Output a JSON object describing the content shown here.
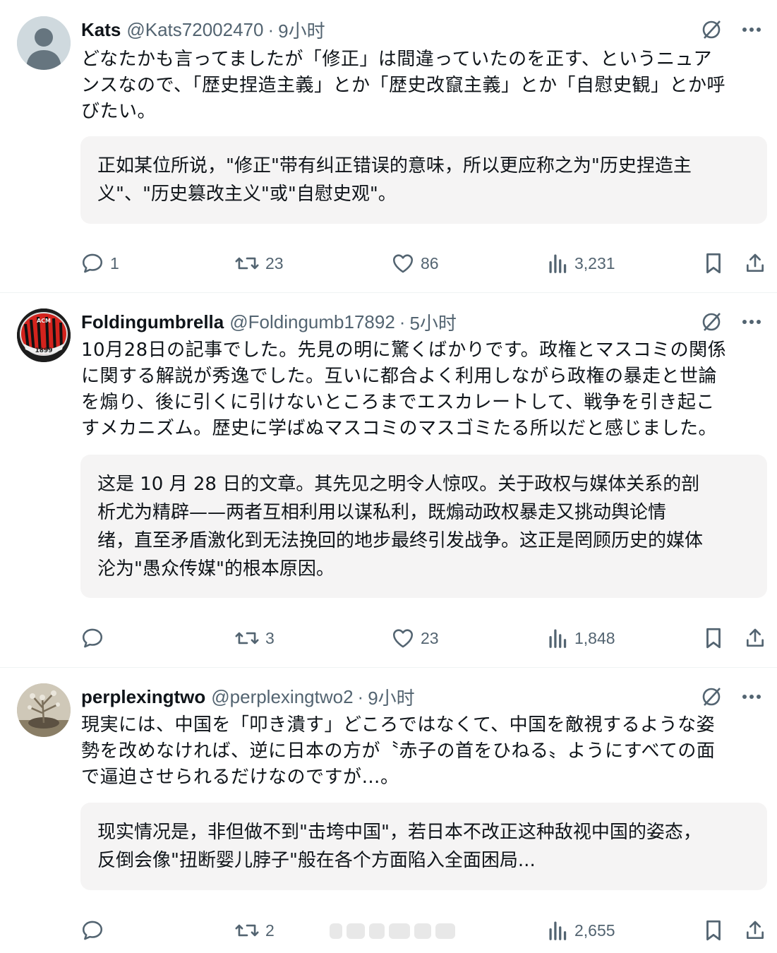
{
  "colors": {
    "text_primary": "#0f1419",
    "text_secondary": "#536471",
    "divider": "#eff3f4",
    "translation_bg": "#f5f4f4"
  },
  "posts": [
    {
      "name": "Kats",
      "handle": "@Kats72002470",
      "separator": "·",
      "time": "9小时",
      "avatar": "default-avatar",
      "text_lines": [
        "どなたかも言ってましたが「修正」は間違っていたのを正す、というニュア",
        "ンスなので、「歴史捏造主義」とか「歴史改竄主義」とか「自慰史観」とか呼",
        "びたい。"
      ],
      "translation_lines": [
        "正如某位所说，\"修正\"带有纠正错误的意味，所以更应称之为\"历史捏造主",
        "义\"、\"历史篡改主义\"或\"自慰史观\"。"
      ],
      "replies": "1",
      "reposts": "23",
      "likes": "86",
      "views": "3,231"
    },
    {
      "name": "Foldingumbrella",
      "handle": "@Foldingumb17892",
      "separator": "·",
      "time": "5小时",
      "avatar": "ac-milan-logo",
      "avatar_text": "ACM 1899",
      "text_lines": [
        "10月28日の記事でした。先見の明に驚くばかりです。政権とマスコミの関係",
        "に関する解説が秀逸でした。互いに都合よく利用しながら政権の暴走と世論",
        "を煽り、後に引くに引けないところまでエスカレートして、戦争を引き起こ",
        "すメカニズム。歴史に学ばぬマスコミのマスゴミたる所以だと感じました。"
      ],
      "translation_lines": [
        "这是 10 月 28 日的文章。其先见之明令人惊叹。关于政权与媒体关系的剖",
        "析尤为精辟——两者互相利用以谋私利，既煽动政权暴走又挑动舆论情",
        "绪，直至矛盾激化到无法挽回的地步最终引发战争。这正是罔顾历史的媒体",
        "沦为\"愚众传媒\"的根本原因。"
      ],
      "replies": "",
      "reposts": "3",
      "likes": "23",
      "views": "1,848"
    },
    {
      "name": "perplexingtwo",
      "handle": "@perplexingtwo2",
      "separator": "·",
      "time": "9小时",
      "avatar": "plant-photo",
      "text_lines": [
        "現実には、中国を「叩き潰す」どころではなくて、中国を敵視するような姿",
        "勢を改めなければ、逆に日本の方が〝赤子の首をひねる〟ようにすべての面",
        "で逼迫させられるだけなのですが…。"
      ],
      "translation_lines": [
        "现实情况是，非但做不到\"击垮中国\"，若日本不改正这种敌视中国的姿态，",
        "反倒会像\"扭断婴儿脖子\"般在各个方面陷入全面困局..."
      ],
      "replies": "",
      "reposts": "2",
      "likes": "",
      "views": "2,655"
    }
  ]
}
